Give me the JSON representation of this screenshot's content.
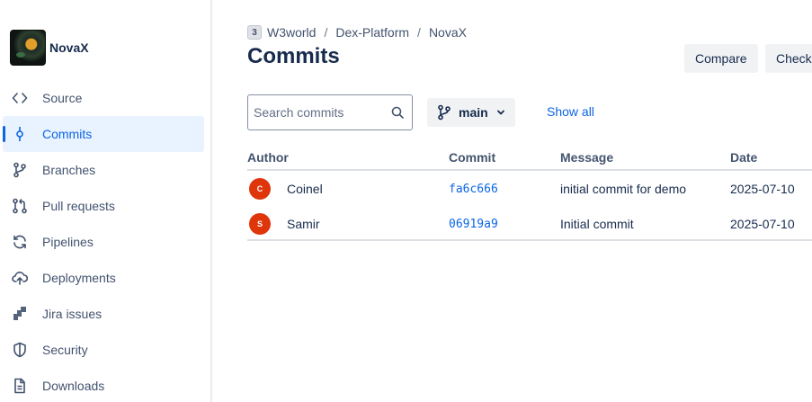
{
  "repo": {
    "name": "NovaX",
    "avatar_icon": "repo-avatar"
  },
  "sidebar": {
    "items": [
      {
        "label": "Source",
        "icon": "code-icon",
        "active": false
      },
      {
        "label": "Commits",
        "icon": "commit-icon",
        "active": true
      },
      {
        "label": "Branches",
        "icon": "branch-icon",
        "active": false
      },
      {
        "label": "Pull requests",
        "icon": "pull-request-icon",
        "active": false
      },
      {
        "label": "Pipelines",
        "icon": "pipeline-icon",
        "active": false
      },
      {
        "label": "Deployments",
        "icon": "cloud-upload-icon",
        "active": false
      },
      {
        "label": "Jira issues",
        "icon": "jira-icon",
        "active": false
      },
      {
        "label": "Security",
        "icon": "shield-icon",
        "active": false
      },
      {
        "label": "Downloads",
        "icon": "file-icon",
        "active": false
      }
    ]
  },
  "breadcrumb": {
    "workspace_icon_text": "3",
    "items": [
      "W3world",
      "Dex-Platform",
      "NovaX"
    ]
  },
  "page": {
    "title": "Commits"
  },
  "header_buttons": {
    "compare": "Compare",
    "check": "Check"
  },
  "filters": {
    "search_placeholder": "Search commits",
    "branch": "main",
    "show_all": "Show all"
  },
  "table": {
    "headers": {
      "author": "Author",
      "commit": "Commit",
      "message": "Message",
      "date": "Date"
    },
    "rows": [
      {
        "avatar_initial": "C",
        "avatar_color": "#de350b",
        "author": "Coinel",
        "commit": "fa6c666",
        "message": "initial commit for demo",
        "date": "2025-07-10"
      },
      {
        "avatar_initial": "S",
        "avatar_color": "#de350b",
        "author": "Samir",
        "commit": "06919a9",
        "message": "Initial commit",
        "date": "2025-07-10"
      }
    ]
  },
  "colors": {
    "accent": "#0c66e4",
    "active_bg": "#e9f2ff",
    "avatar": "#de350b"
  }
}
